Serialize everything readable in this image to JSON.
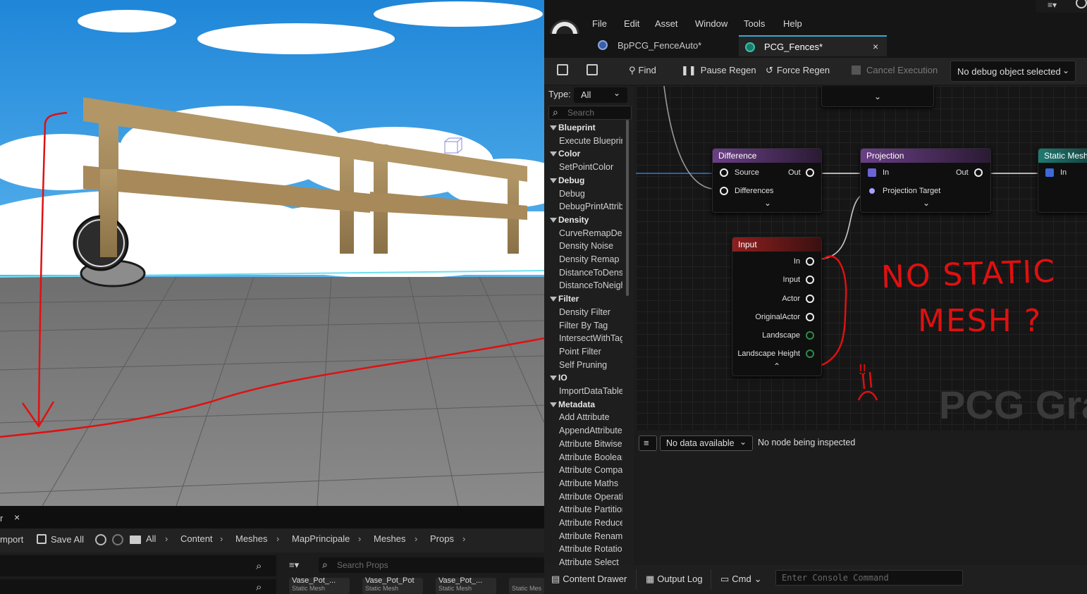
{
  "content_browser": {
    "tab_label": "r",
    "close_glyph": "×",
    "import_label": "mport",
    "save_all_label": "Save All",
    "breadcrumbs": [
      "All",
      "Content",
      "Meshes",
      "MapPrincipale",
      "Meshes",
      "Props"
    ],
    "search_placeholder": "Search Props",
    "assets": [
      {
        "name": "Vase_Pot_...",
        "type": "Static Mesh"
      },
      {
        "name": "Vase_Pot_Pot",
        "type": "Static Mesh"
      },
      {
        "name": "Vase_Pot_...",
        "type": "Static Mesh"
      },
      {
        "name": "",
        "type": "Static Mes"
      }
    ]
  },
  "pcg_editor": {
    "menu": [
      "File",
      "Edit",
      "Asset",
      "Window",
      "Tools",
      "Help"
    ],
    "tabs": [
      {
        "label": "BpPCG_FenceAuto*"
      },
      {
        "label": "PCG_Fences*"
      }
    ],
    "tab_close_glyph": "×",
    "toolbar": {
      "find": "Find",
      "pause_regen": "Pause Regen",
      "force_regen": "Force Regen",
      "cancel_execution": "Cancel Execution",
      "debug_object": "No debug object selected"
    },
    "palette": {
      "type_label": "Type:",
      "type_value": "All",
      "search_placeholder": "Search",
      "entries": [
        {
          "kind": "cat",
          "text": "Blueprint"
        },
        {
          "kind": "item",
          "text": "Execute Blueprint"
        },
        {
          "kind": "cat",
          "text": "Color"
        },
        {
          "kind": "item",
          "text": "SetPointColor"
        },
        {
          "kind": "cat",
          "text": "Debug"
        },
        {
          "kind": "item",
          "text": "Debug"
        },
        {
          "kind": "item",
          "text": "DebugPrintAttribute"
        },
        {
          "kind": "cat",
          "text": "Density"
        },
        {
          "kind": "item",
          "text": "CurveRemapDensity"
        },
        {
          "kind": "item",
          "text": "Density Noise"
        },
        {
          "kind": "item",
          "text": "Density Remap"
        },
        {
          "kind": "item",
          "text": "DistanceToDensity"
        },
        {
          "kind": "item",
          "text": "DistanceToNeighbors"
        },
        {
          "kind": "cat",
          "text": "Filter"
        },
        {
          "kind": "item",
          "text": "Density Filter"
        },
        {
          "kind": "item",
          "text": "Filter By Tag"
        },
        {
          "kind": "item",
          "text": "IntersectWithTag"
        },
        {
          "kind": "item",
          "text": "Point Filter"
        },
        {
          "kind": "item",
          "text": "Self Pruning"
        },
        {
          "kind": "cat",
          "text": "IO"
        },
        {
          "kind": "item",
          "text": "ImportDataTable"
        },
        {
          "kind": "cat",
          "text": "Metadata"
        },
        {
          "kind": "item",
          "text": "Add Attribute"
        },
        {
          "kind": "item",
          "text": "AppendAttributes"
        },
        {
          "kind": "item",
          "text": "Attribute Bitwise"
        },
        {
          "kind": "item",
          "text": "Attribute Boolean"
        },
        {
          "kind": "item",
          "text": "Attribute Compare"
        },
        {
          "kind": "item",
          "text": "Attribute Maths"
        },
        {
          "kind": "item",
          "text": "Attribute Operation"
        },
        {
          "kind": "item",
          "text": "Attribute Partition"
        },
        {
          "kind": "item",
          "text": "Attribute Reduce"
        },
        {
          "kind": "item",
          "text": "Attribute Rename"
        },
        {
          "kind": "item",
          "text": "Attribute Rotation"
        },
        {
          "kind": "item",
          "text": "Attribute Select"
        }
      ]
    },
    "nodes": {
      "difference": {
        "title": "Difference",
        "pins": [
          "Source",
          "Out",
          "Differences"
        ]
      },
      "projection": {
        "title": "Projection",
        "pins": [
          "In",
          "Out",
          "Projection Target"
        ]
      },
      "static_mesh": {
        "title": "Static Mesh",
        "pins": [
          "In"
        ]
      },
      "input": {
        "title": "Input",
        "pins": [
          "In",
          "Input",
          "Actor",
          "OriginalActor",
          "Landscape",
          "Landscape Height"
        ]
      }
    },
    "graph_watermark": "PCG Gra",
    "annotation_text": [
      "NO STATIC",
      "MESH ?",
      "!!"
    ],
    "inspector": {
      "data_dropdown": "No data available",
      "status": "No node being inspected"
    },
    "statusbar": {
      "content_drawer": "Content Drawer",
      "output_log": "Output Log",
      "cmd": "Cmd",
      "console_placeholder": "Enter Console Command"
    },
    "colors": {
      "difference_header": "#6b3f86",
      "projection_header": "#6b3f86",
      "static_mesh_header": "#1f7a72",
      "input_header": "#8e1f1f",
      "annotation": "#e01010"
    }
  }
}
